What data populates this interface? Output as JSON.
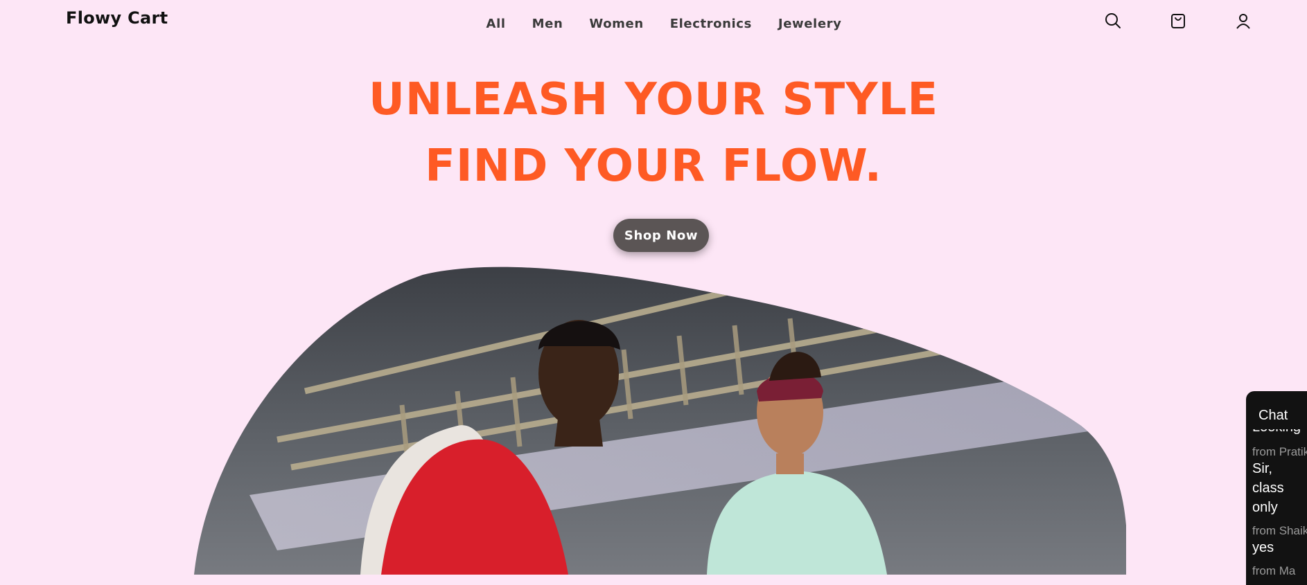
{
  "brand": {
    "name": "Flowy Cart"
  },
  "nav": {
    "items": [
      {
        "label": "All"
      },
      {
        "label": "Men"
      },
      {
        "label": "Women"
      },
      {
        "label": "Electronics"
      },
      {
        "label": "Jewelery"
      }
    ]
  },
  "header_icons": [
    "search-icon",
    "shopping-bag-icon",
    "user-icon"
  ],
  "hero": {
    "line1": "UNLEASH YOUR STYLE",
    "line2": "FIND YOUR FLOW.",
    "cta_label": "Shop Now",
    "image_desc": "two young men browsing"
  },
  "chat": {
    "title": "Chat",
    "partial_text": "Looking",
    "messages": [
      {
        "from": "from Pratik",
        "text": "Sir, class only"
      },
      {
        "from": "from Shaik",
        "text": "yes"
      },
      {
        "from": "from Ma",
        "text": ""
      }
    ]
  },
  "colors": {
    "background": "#fde6f6",
    "accent": "#fe5a24",
    "button": "#5b5555",
    "chat_bg": "#121212"
  }
}
